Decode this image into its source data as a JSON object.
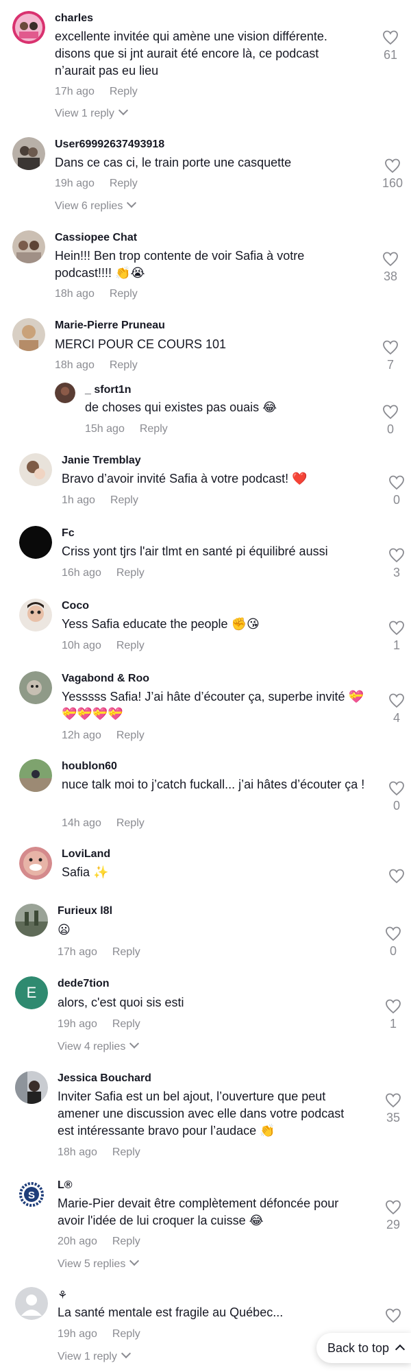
{
  "comments": [
    {
      "user": "charles",
      "text": "excellente invitée qui amène une vision différente. disons que si jnt aurait été encore là, ce podcast n’aurait pas eu lieu",
      "time": "17h ago",
      "reply": "Reply",
      "likes": "61",
      "view_replies": "View 1 reply"
    },
    {
      "user": "User69992637493918",
      "text": "Dans ce cas ci, le train porte une casquette",
      "time": "19h ago",
      "reply": "Reply",
      "likes": "160",
      "view_replies": "View 6 replies"
    },
    {
      "user": "Cassiopee Chat",
      "text": "Hein!!! Ben trop contente de voir Safia à votre podcast!!!! 👏😭",
      "time": "18h ago",
      "reply": "Reply",
      "likes": "38"
    },
    {
      "user": "Marie-Pierre Pruneau",
      "text": "MERCI POUR CE COURS 101",
      "time": "18h ago",
      "reply": "Reply",
      "likes": "7",
      "sub": {
        "user": "_ sfort1n",
        "text": "de choses qui existes pas ouais 😂",
        "time": "15h ago",
        "reply": "Reply",
        "likes": "0"
      }
    },
    {
      "user": "Janie Tremblay",
      "text": "Bravo d’avoir invité Safia à votre podcast! ❤️",
      "time": "1h ago",
      "reply": "Reply",
      "likes": "0"
    },
    {
      "user": "Fc",
      "text": "Criss yont tjrs l'air tlmt en santé pi équilibré aussi",
      "time": "16h ago",
      "reply": "Reply",
      "likes": "3"
    },
    {
      "user": "Coco",
      "text": "Yess Safia educate the people ✊😘",
      "time": "10h ago",
      "reply": "Reply",
      "likes": "1"
    },
    {
      "user": "Vagabond & Roo",
      "text": "Yesssss Safia! J’ai hâte d’écouter ça, superbe invité 💝💝💝💝💝",
      "time": "12h ago",
      "reply": "Reply",
      "likes": "4"
    },
    {
      "user": "houblon60",
      "text": "nuce talk moi to j’catch fuckall... j’ai hâtes d’écouter ça !",
      "time": "14h ago",
      "reply": "Reply",
      "likes": "0"
    },
    {
      "user": "LoviLand",
      "text": "Safia ✨"
    },
    {
      "user": "Furieux l8l",
      "text": "😦",
      "time": "17h ago",
      "reply": "Reply",
      "likes": "0"
    },
    {
      "user": "dede7tion",
      "text": "alors, c'est quoi sis esti",
      "time": "19h ago",
      "reply": "Reply",
      "likes": "1",
      "view_replies": "View 4 replies",
      "avatar_letter": "E"
    },
    {
      "user": "Jessica Bouchard",
      "text": "Inviter Safia est un bel ajout, l’ouverture que peut amener une discussion avec elle dans votre podcast est intéressante bravo pour l’audace 👏",
      "time": "18h ago",
      "reply": "Reply",
      "likes": "35"
    },
    {
      "user": "L®",
      "text": "Marie-Pier devait être complètement défoncée pour avoir l'idée de lui croquer la cuisse 😂",
      "time": "20h ago",
      "reply": "Reply",
      "likes": "29",
      "view_replies": "View 5 replies",
      "avatar_letter": "S"
    },
    {
      "user": "⚘",
      "text": "La santé mentale est fragile au Québec...",
      "time": "19h ago",
      "reply": "Reply",
      "view_replies": "View 1 reply"
    }
  ],
  "back_to_top": "Back to top",
  "colors": {
    "text": "#161823",
    "muted": "#8a8b91",
    "avatar_e": "#2f8a70",
    "avatar_s": "#1f3e7a"
  }
}
